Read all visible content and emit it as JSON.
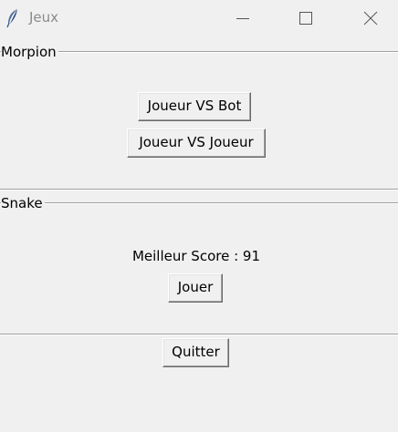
{
  "window": {
    "title": "Jeux",
    "icon": "feather-icon",
    "controls": [
      "minimize-icon",
      "maximize-icon",
      "close-icon"
    ]
  },
  "morpion": {
    "label": "Morpion",
    "buttons": {
      "vs_bot": "Joueur VS Bot",
      "vs_player": "Joueur VS Joueur"
    }
  },
  "snake": {
    "label": "Snake",
    "best_score_text": "Meilleur Score : 91",
    "play_button": "Jouer"
  },
  "quit_button": "Quitter"
}
